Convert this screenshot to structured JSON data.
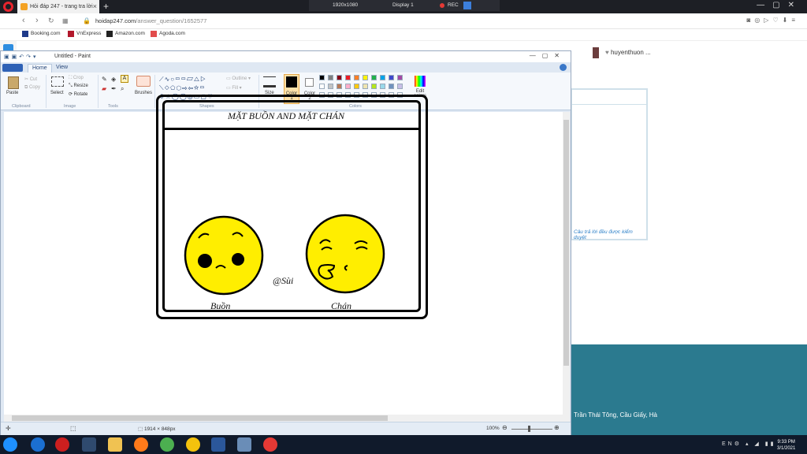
{
  "browser": {
    "tab_title": "Hỏi đáp 247 - trang tra lời",
    "url_domain": "hoidap247.com",
    "url_path": "/answer_question/1652577",
    "bookmarks": [
      "Booking.com",
      "VnExpress",
      "Amazon.com",
      "Agoda.com"
    ],
    "recorder": {
      "resolution": "1920x1080",
      "display": "Display 1",
      "rec": "REC"
    }
  },
  "page": {
    "username": "huyenthuon ...",
    "card_note": "Câu trả lời đều được kiểm duyệt",
    "footer_address": "Trần Thái Tông, Cầu Giấy, Hà"
  },
  "paint": {
    "window_title": "Untitled - Paint",
    "tabs": [
      "Home",
      "View"
    ],
    "clipboard": {
      "paste": "Paste",
      "cut": "Cut",
      "copy": "Copy",
      "group": "Clipboard"
    },
    "image": {
      "select": "Select",
      "crop": "Crop",
      "resize": "Resize",
      "rotate": "Rotate",
      "group": "Image"
    },
    "tools_group": "Tools",
    "brushes": "Brushes",
    "shapes": {
      "outline": "Outline",
      "fill": "Fill",
      "group": "Shapes"
    },
    "size": "Size",
    "color1": "Color 1",
    "color2": "Color 2",
    "edit_colors": "Edit colors",
    "colors_group": "Colors",
    "palette": [
      "#000000",
      "#7f7f7f",
      "#880015",
      "#ed1c24",
      "#ff7f27",
      "#fff200",
      "#22b14c",
      "#00a2e8",
      "#3f48cc",
      "#a349a4",
      "#ffffff",
      "#c3c3c3",
      "#b97a57",
      "#ffaec9",
      "#ffc90e",
      "#efe4b0",
      "#b5e61d",
      "#99d9ea",
      "#7092be",
      "#c8bfe7"
    ],
    "status_dimensions": "1914 × 848px",
    "zoom": "100%"
  },
  "drawing": {
    "title": "MẶT BUỒN AND MẶT CHÁN",
    "sad_label": "Buồn",
    "bored_label": "Chán",
    "signature": "@Sùi"
  },
  "taskbar": {
    "time": "9:33 PM",
    "date": "3/1/2021"
  }
}
